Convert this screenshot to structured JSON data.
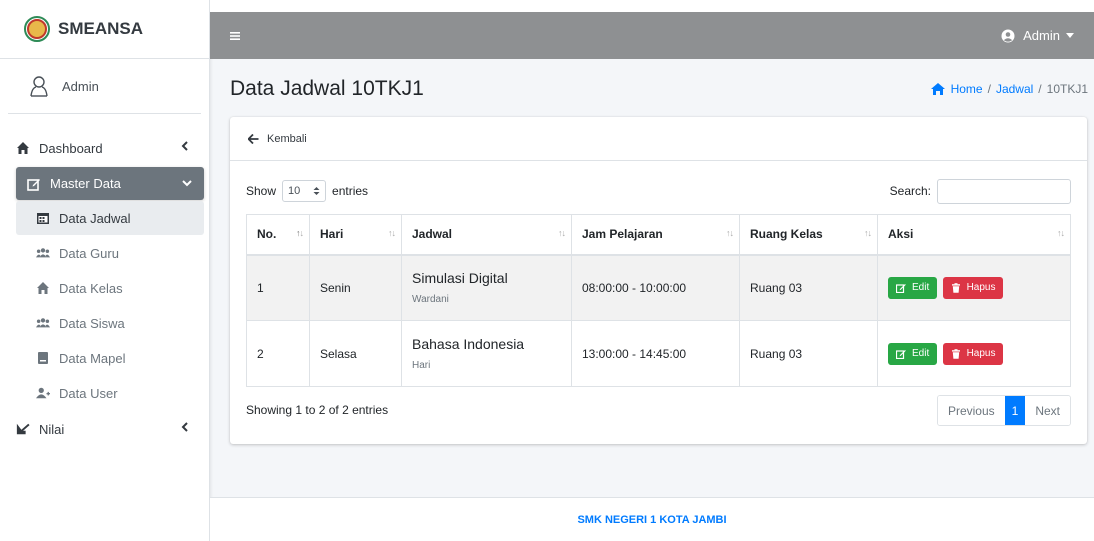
{
  "brand": {
    "name": "SMEANSA"
  },
  "sidebar": {
    "user": "Admin",
    "items": [
      {
        "label": "Dashboard",
        "icon": "home-icon"
      },
      {
        "label": "Master Data",
        "icon": "edit-icon"
      },
      {
        "label": "Data Jadwal",
        "icon": "calendar-icon"
      },
      {
        "label": "Data Guru",
        "icon": "users-icon"
      },
      {
        "label": "Data Kelas",
        "icon": "home-icon"
      },
      {
        "label": "Data Siswa",
        "icon": "users-icon"
      },
      {
        "label": "Data Mapel",
        "icon": "book-icon"
      },
      {
        "label": "Data User",
        "icon": "user-plus-icon"
      },
      {
        "label": "Nilai",
        "icon": "signature-icon"
      }
    ]
  },
  "topbar": {
    "user_label": "Admin"
  },
  "header": {
    "title": "Data Jadwal 10TKJ1",
    "breadcrumb": [
      "Home",
      "Jadwal",
      "10TKJ1"
    ]
  },
  "card": {
    "back_label": "Kembali",
    "show_label": "Show",
    "entries_value": "10",
    "entries_label": "entries",
    "search_label": "Search:",
    "search_value": ""
  },
  "table": {
    "headers": [
      "No.",
      "Hari",
      "Jadwal",
      "Jam Pelajaran",
      "Ruang Kelas",
      "Aksi"
    ],
    "rows": [
      {
        "no": "1",
        "hari": "Senin",
        "mapel": "Simulasi Digital",
        "guru": "Wardani",
        "jam": "08:00:00 - 10:00:00",
        "ruang": "Ruang 03"
      },
      {
        "no": "2",
        "hari": "Selasa",
        "mapel": "Bahasa Indonesia",
        "guru": "Hari",
        "jam": "13:00:00 - 14:45:00",
        "ruang": "Ruang 03"
      }
    ],
    "edit_label": "Edit",
    "hapus_label": "Hapus"
  },
  "footer_info": "Showing 1 to 2 of 2 entries",
  "pagination": {
    "previous": "Previous",
    "current": "1",
    "next": "Next"
  },
  "footer": {
    "text": "SMK NEGERI 1 KOTA JAMBI"
  },
  "colors": {
    "topbar": "#8e9092",
    "active_nav": "#6c757d",
    "primary": "#007bff",
    "edit": "#28a745",
    "hapus": "#dc3545"
  }
}
